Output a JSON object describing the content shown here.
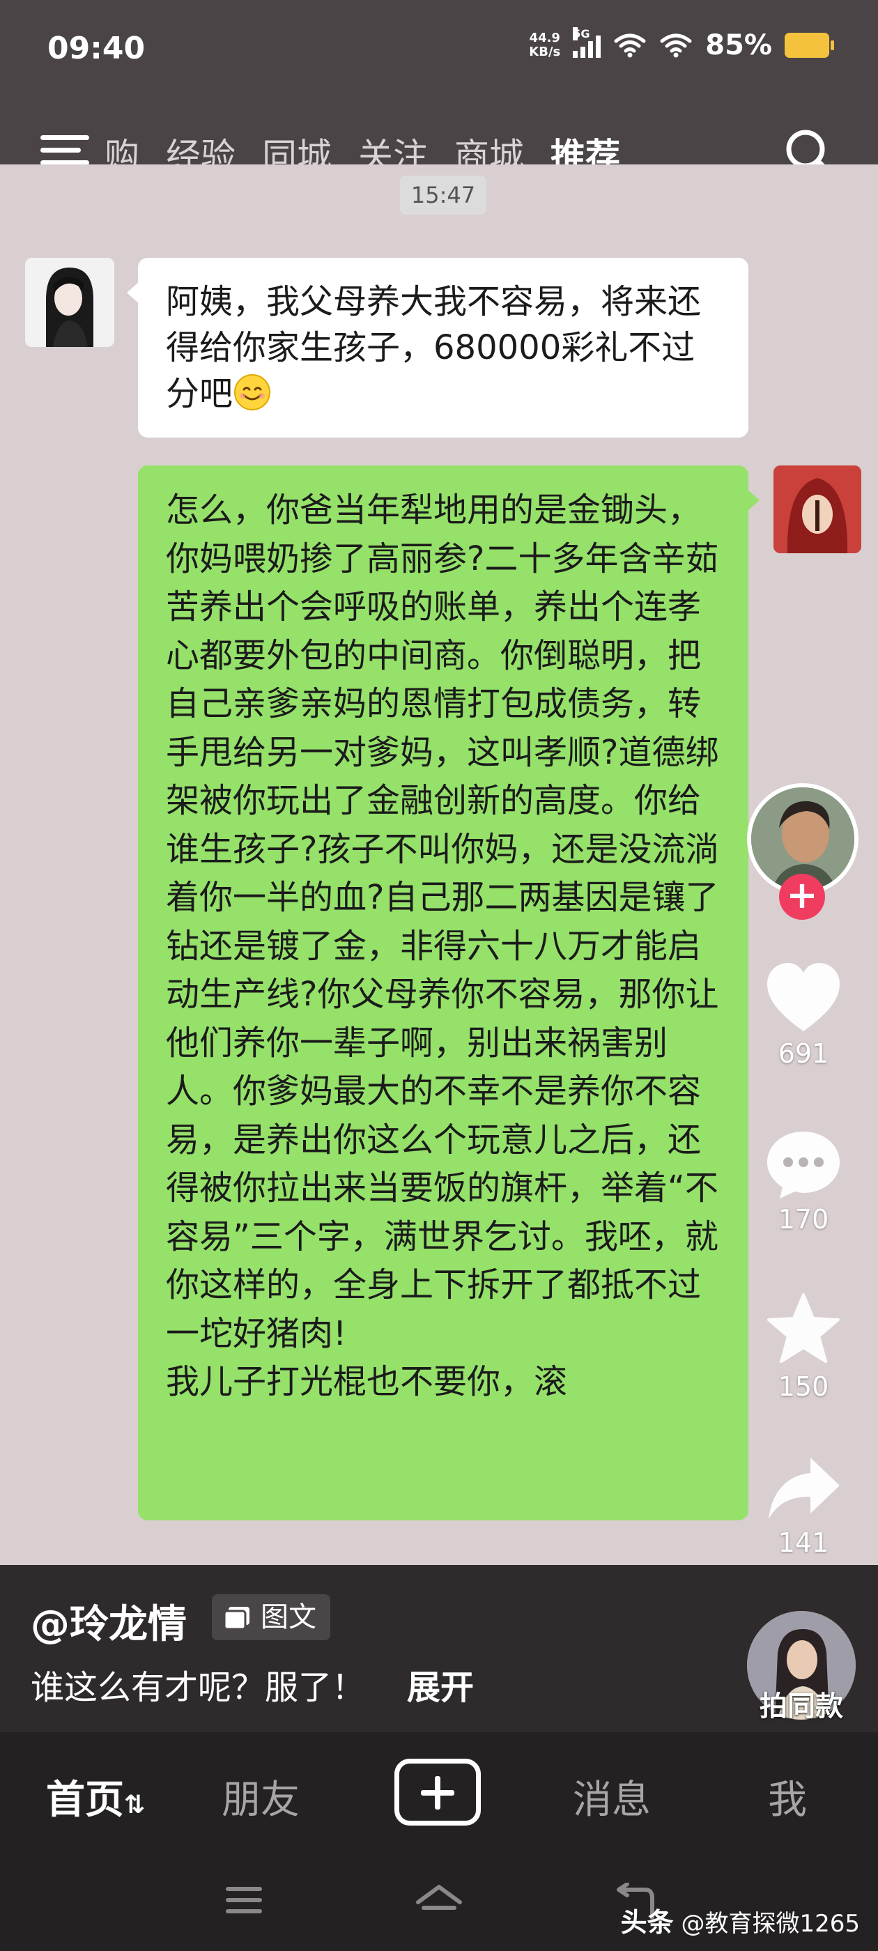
{
  "status_bar": {
    "time": "09:40",
    "net_speed_value": "44.9",
    "net_speed_unit": "KB/s",
    "network": "5G",
    "battery": "85%"
  },
  "nav": {
    "tabs": [
      "购",
      "经验",
      "同城",
      "关注",
      "商城",
      "推荐"
    ],
    "active_tab": "推荐"
  },
  "chat": {
    "timestamp": "15:47",
    "message_left": "阿姨，我父母养大我不容易，将来还得给你家生孩子，680000彩礼不过分吧",
    "message_right_lines": [
      "怎么，你爸当年犁地用的是金锄头，你妈喂奶掺了高丽参?二十多年含辛茹苦养出个会呼吸的账单，养出个连孝心都要外包的中间商。你倒聪明，把自己亲爹亲妈的恩情打包成债务，转手甩给另一对爹妈，这叫孝顺?道德绑架被你玩出了金融创新的高度。你给谁生孩子?孩子不叫你妈，还是没流淌着你一半的血?自己那二两基因是镶了钻还是镀了金，非得六十八万才能启动生产线?你父母养你不容易，那你让他们养你一辈子啊，别出来祸害别人。你爹妈最大的不幸不是养你不容易，是养出你这么个玩意儿之后，还得被你拉出来当要饭的旗杆，举着“不容易”三个字，满世界乞讨。我呸，就你这样的，全身上下拆开了都抵不过一坨好猪肉!",
      "我儿子打光棍也不要你，滚"
    ]
  },
  "actions": {
    "likes": "691",
    "comments": "170",
    "favorites": "150",
    "shares": "141",
    "follow_symbol": "+"
  },
  "post": {
    "author": "@玲龙情",
    "type_badge": "图文",
    "description": "谁这么有才呢？服了！",
    "expand": "展开",
    "same_style": "拍同款"
  },
  "tabbar": {
    "home": "首页",
    "home_suffix": "⇅",
    "friends": "朋友",
    "messages": "消息",
    "me": "我"
  },
  "watermark": {
    "source": "头条",
    "handle": "@教育探微1265"
  },
  "colors": {
    "bubble_green": "#95e16a",
    "bubble_white": "#ffffff",
    "follow_red": "#f03c5f",
    "battery_yellow": "#f4c23c"
  }
}
